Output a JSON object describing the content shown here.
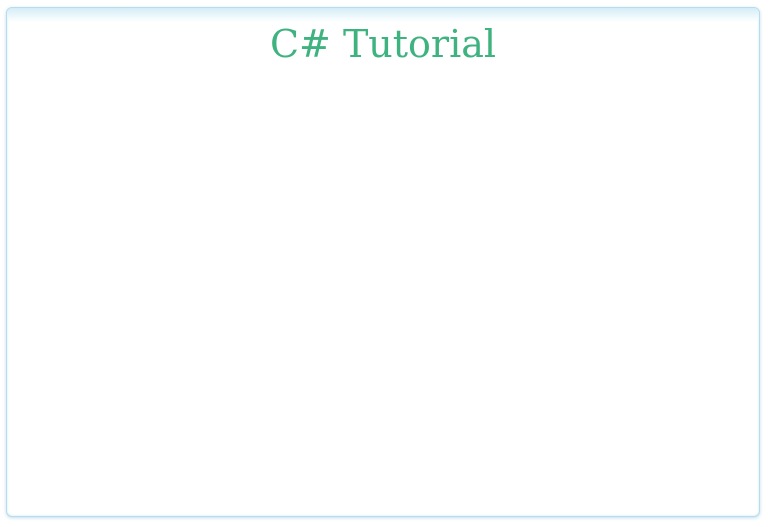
{
  "page": {
    "title": "C# Tutorial"
  },
  "colors": {
    "title": "#3fb37f",
    "frame_border": "#b9dcec",
    "frame_glow": "#d4ecf7",
    "background": "#ffffff"
  }
}
